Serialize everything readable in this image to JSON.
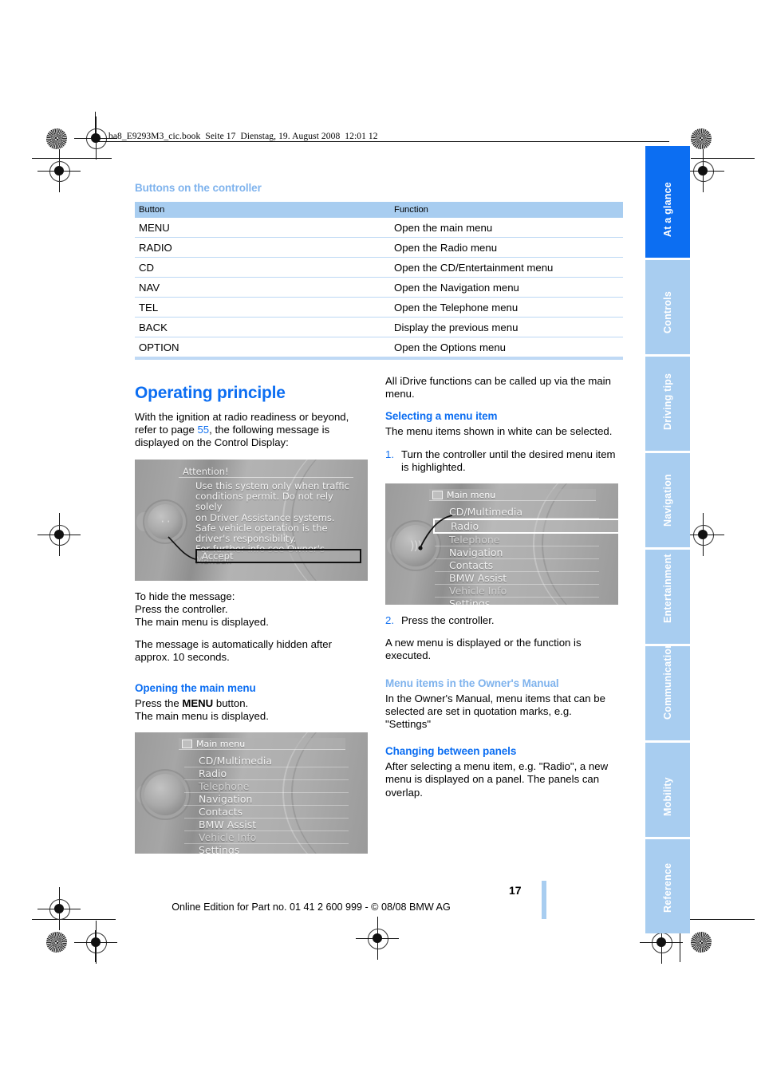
{
  "running_header": "ba8_E9293M3_cic.book  Seite 17  Dienstag, 19. August 2008  12:01 12",
  "table_section": {
    "heading": "Buttons on the controller",
    "columns": [
      "Button",
      "Function"
    ],
    "rows": [
      [
        "MENU",
        "Open the main menu"
      ],
      [
        "RADIO",
        "Open the Radio menu"
      ],
      [
        "CD",
        "Open the CD/Entertainment menu"
      ],
      [
        "NAV",
        "Open the Navigation menu"
      ],
      [
        "TEL",
        "Open the Telephone menu"
      ],
      [
        "BACK",
        "Display the previous menu"
      ],
      [
        "OPTION",
        "Open the Options menu"
      ]
    ]
  },
  "left_column": {
    "title": "Operating principle",
    "intro_part1": "With the ignition at radio readiness or beyond, refer to page ",
    "intro_link": "55",
    "intro_part2": ", the following message is displayed on the Control Display:",
    "hide_line1": "To hide the message:",
    "hide_line2": "Press the controller.",
    "hide_line3": "The main menu is displayed.",
    "auto_hide": "The message is automatically hidden after approx. 10 seconds.",
    "opening_heading": "Opening the main menu",
    "opening_line1_pre": "Press the ",
    "opening_line1_bold": "MENU",
    "opening_line1_post": " button.",
    "opening_line2": "The main menu is displayed."
  },
  "right_column": {
    "intro": "All iDrive functions can be called up via the main menu.",
    "selecting_heading": "Selecting a menu item",
    "selecting_text": "The menu items shown in white can be selected.",
    "step1_num": "1.",
    "step1_text": "Turn the controller until the desired menu item is highlighted.",
    "step2_num": "2.",
    "step2_text": "Press the controller.",
    "after_step2": "A new menu is displayed or the function is executed.",
    "ownersmanual_heading": "Menu items in the Owner's Manual",
    "ownersmanual_text": "In the Owner's Manual, menu items that can be selected are set in quotation marks, e.g. \"Settings\"",
    "panels_heading": "Changing between panels",
    "panels_text": "After selecting a menu item, e.g. \"Radio\", a new menu is displayed on a panel. The panels can overlap."
  },
  "screenshot_attention": {
    "title": "Attention!",
    "body_lines": [
      "Use this system only when traffic",
      "conditions permit. Do not rely solely",
      "on Driver Assistance systems.",
      "Safe vehicle operation is the",
      "driver's responsibility.",
      "For further info see Owner's Manual."
    ],
    "button_label": "Accept"
  },
  "screenshot_mainmenu_left": {
    "title": "Main menu",
    "items": [
      "CD/Multimedia",
      "Radio",
      "Telephone",
      "Navigation",
      "Contacts",
      "BMW Assist",
      "Vehicle Info",
      "Settings"
    ]
  },
  "screenshot_mainmenu_right": {
    "title": "Main menu",
    "items": [
      "CD/Multimedia",
      "Radio",
      "Telephone",
      "Navigation",
      "Contacts",
      "BMW Assist",
      "Vehicle Info",
      "Settings"
    ],
    "highlighted_item": "Radio"
  },
  "thumb_index": {
    "tabs": [
      {
        "label": "At a glance",
        "active": true
      },
      {
        "label": "Controls",
        "active": false
      },
      {
        "label": "Driving tips",
        "active": false
      },
      {
        "label": "Navigation",
        "active": false
      },
      {
        "label": "Entertainment",
        "active": false
      },
      {
        "label": "Communications",
        "active": false
      },
      {
        "label": "Mobility",
        "active": false
      },
      {
        "label": "Reference",
        "active": false
      }
    ]
  },
  "footer": {
    "page_number": "17",
    "legal": "Online Edition for Part no. 01 41 2 600 999 - © 08/08 BMW AG"
  },
  "colors": {
    "accent_blue": "#0c6ef2",
    "pale_blue": "#a8cdf0",
    "heading_pale": "#7fb3ed"
  }
}
